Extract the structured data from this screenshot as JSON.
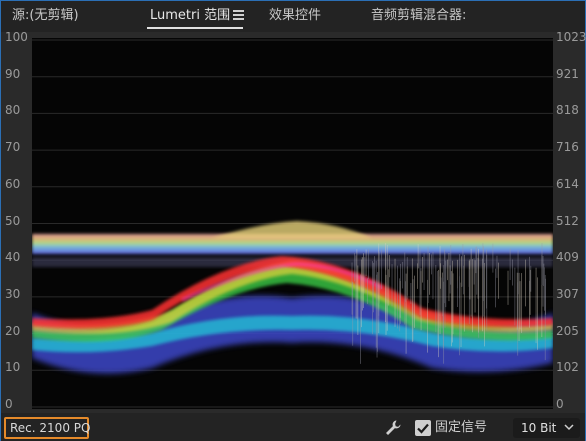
{
  "tabs": [
    {
      "label": "源:(无剪辑)",
      "active": false
    },
    {
      "label": "Lumetri 范围",
      "active": true
    },
    {
      "label": "效果控件",
      "active": false
    },
    {
      "label": "音频剪辑混合器:",
      "active": false
    }
  ],
  "scope": {
    "left_axis": [
      "100",
      "90",
      "80",
      "70",
      "60",
      "50",
      "40",
      "30",
      "20",
      "10",
      "0"
    ],
    "right_axis": [
      "1023",
      "921",
      "818",
      "716",
      "614",
      "512",
      "409",
      "307",
      "205",
      "102",
      "0"
    ]
  },
  "bottom": {
    "color_space": "Rec. 2100 PQ",
    "clamp_label": "固定信号",
    "clamp_checked": true,
    "bit_depth": "10 Bit"
  },
  "icons": {
    "menu": "hamburger-icon",
    "settings": "wrench-icon",
    "dropdown": "chevron-down-icon",
    "check": "checkmark-icon"
  },
  "colors": {
    "highlight_border": "#e58a2a",
    "window_border": "#2b6fb5"
  }
}
